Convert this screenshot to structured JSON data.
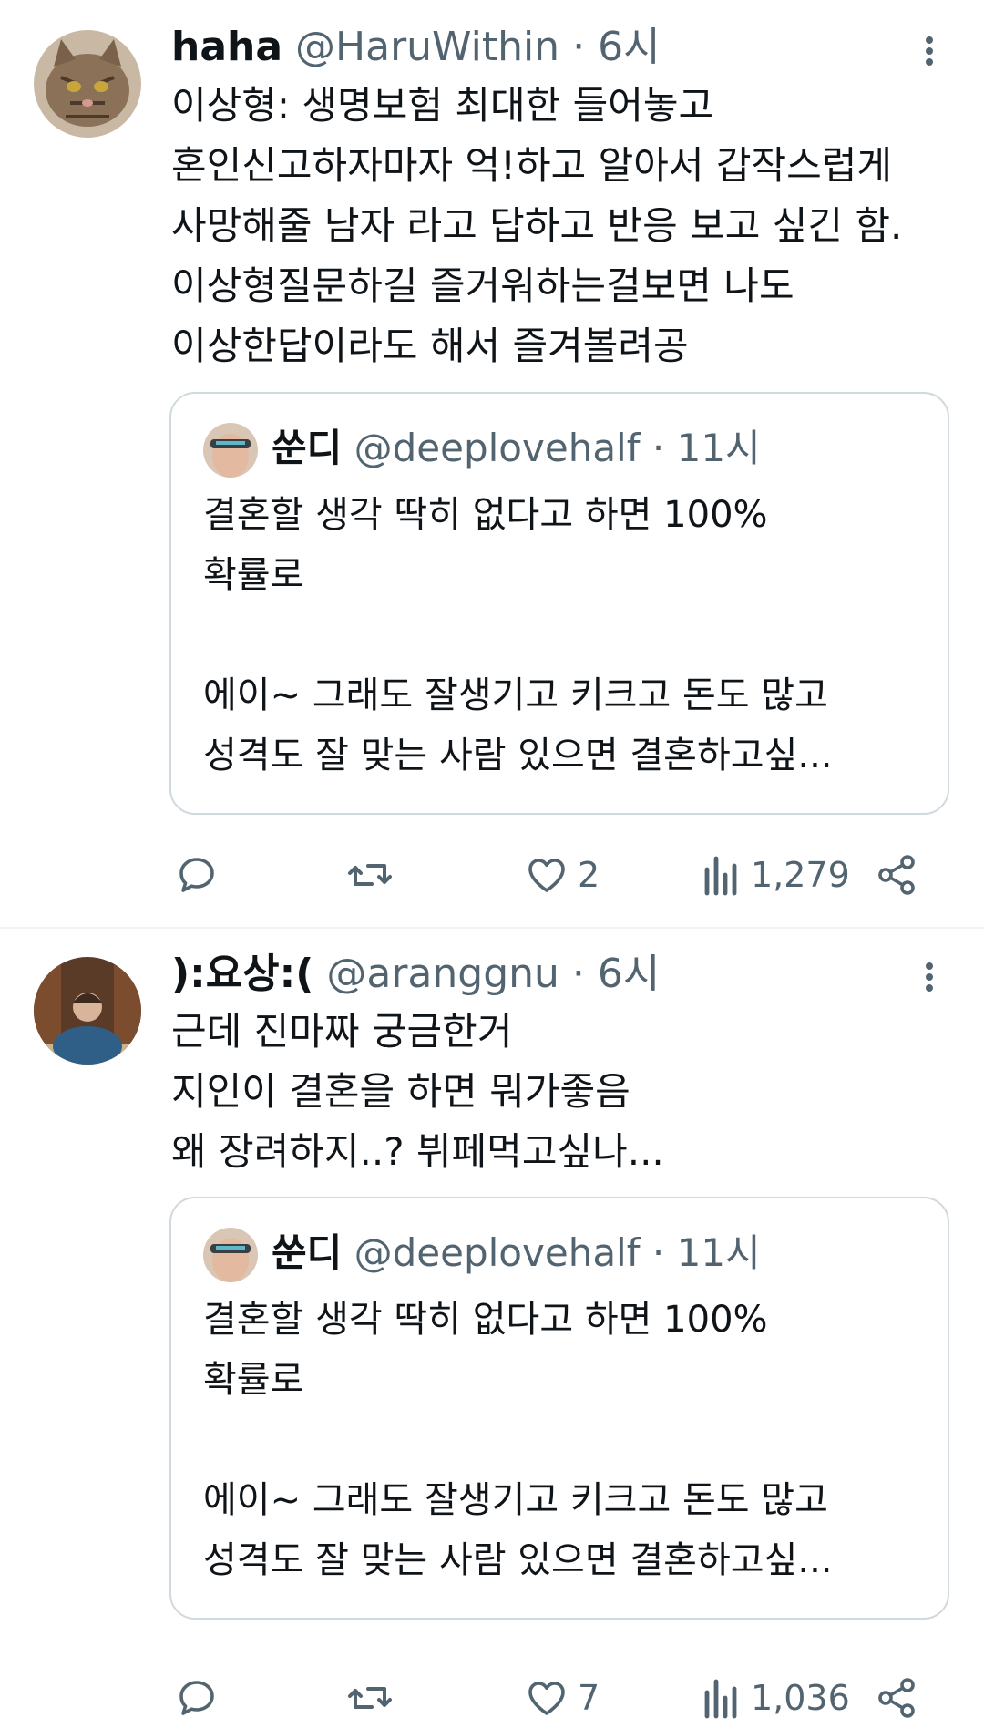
{
  "tweets": [
    {
      "name": "haha",
      "handle": "@HaruWithin",
      "separator": "·",
      "time": "6시",
      "avatar_icon": "cat-avatar",
      "lines": [
        "이상형: 생명보험 최대한 들어놓고",
        "혼인신고하자마자 억!하고 알아서 갑작스럽게",
        "사망해줄 남자 라고 답하고 반응 보고 싶긴 함.",
        "이상형질문하길 즐거워하는걸보면 나도",
        "이상한답이라도 해서 즐겨볼려공"
      ],
      "quote": {
        "name": "쑨디",
        "handle": "@deeplovehalf",
        "separator": "·",
        "time": "11시",
        "lines": [
          "결혼할 생각 딱히 없다고 하면 100%",
          "확률로",
          "",
          "에이~ 그래도 잘생기고 키크고 돈도 많고",
          "성격도 잘 맞는 사람 있으면 결혼하고싶..."
        ]
      },
      "likes": "2",
      "views": "1,279"
    },
    {
      "name": "):요상:(",
      "handle": "@aranggnu",
      "separator": "·",
      "time": "6시",
      "avatar_icon": "person-avatar",
      "lines": [
        "근데 진마짜 궁금한거",
        "지인이 결혼을 하면 뭐가좋음",
        "왜 장려하지..? 뷔페먹고싶나..."
      ],
      "quote": {
        "name": "쑨디",
        "handle": "@deeplovehalf",
        "separator": "·",
        "time": "11시",
        "lines": [
          "결혼할 생각 딱히 없다고 하면 100%",
          "확률로",
          "",
          "에이~ 그래도 잘생기고 키크고 돈도 많고",
          "성격도 잘 맞는 사람 있으면 결혼하고싶..."
        ]
      },
      "likes": "7",
      "views": "1,036"
    }
  ],
  "colors": {
    "text": "#0f1419",
    "secondary": "#536471",
    "border": "#cfd9de",
    "divider": "#eff3f4"
  }
}
